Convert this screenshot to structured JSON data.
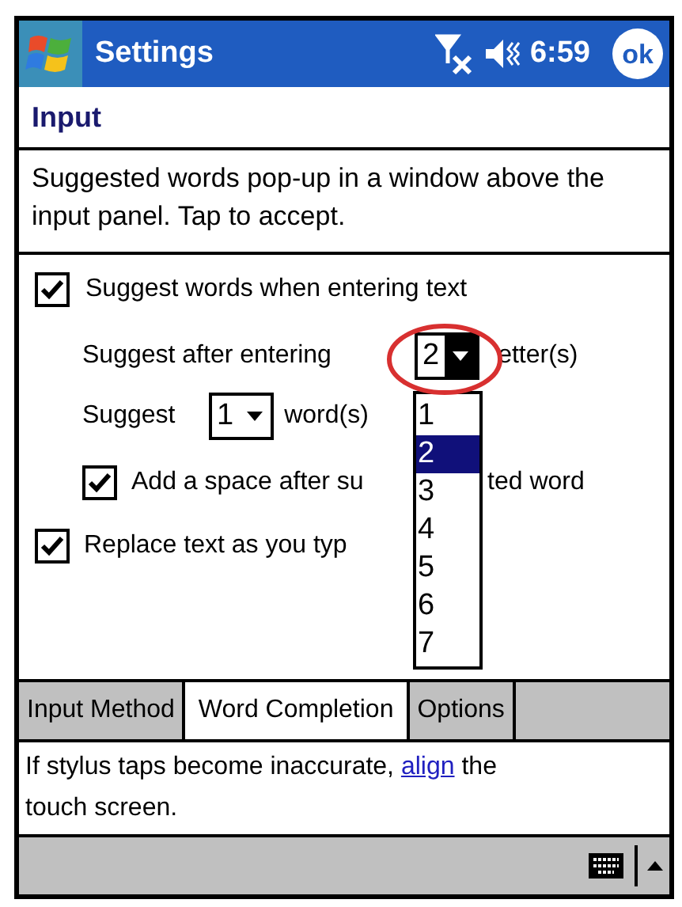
{
  "title_bar": {
    "title": "Settings",
    "time": "6:59",
    "ok": "ok"
  },
  "header": "Input",
  "description": "Suggested words pop-up in a window above the input panel.  Tap to accept.",
  "suggest_words": {
    "label": "Suggest words when entering text",
    "checked": true
  },
  "letters_row": {
    "label": "Suggest after entering",
    "value": "2",
    "suffix": "etter(s)",
    "open": true
  },
  "words_row": {
    "label": "Suggest",
    "value": "1",
    "suffix": "word(s)",
    "open": false
  },
  "add_space": {
    "label_before": "Add a space after su",
    "label_after": "ted word",
    "checked": true
  },
  "replace_text": {
    "label": "Replace text as you typ",
    "checked": true
  },
  "dropdown_list": [
    {
      "label": "1",
      "selected": false
    },
    {
      "label": "2",
      "selected": true
    },
    {
      "label": "3",
      "selected": false
    },
    {
      "label": "4",
      "selected": false
    },
    {
      "label": "5",
      "selected": false
    },
    {
      "label": "6",
      "selected": false
    },
    {
      "label": "7",
      "selected": false
    }
  ],
  "tabs": [
    {
      "label": "Input Method",
      "selected": false
    },
    {
      "label": "Word Completion",
      "selected": true
    },
    {
      "label": "Options",
      "selected": false
    }
  ],
  "footer": {
    "text_before": "If stylus taps become inaccurate,",
    "link": "align",
    "text_after": "the touch screen."
  }
}
